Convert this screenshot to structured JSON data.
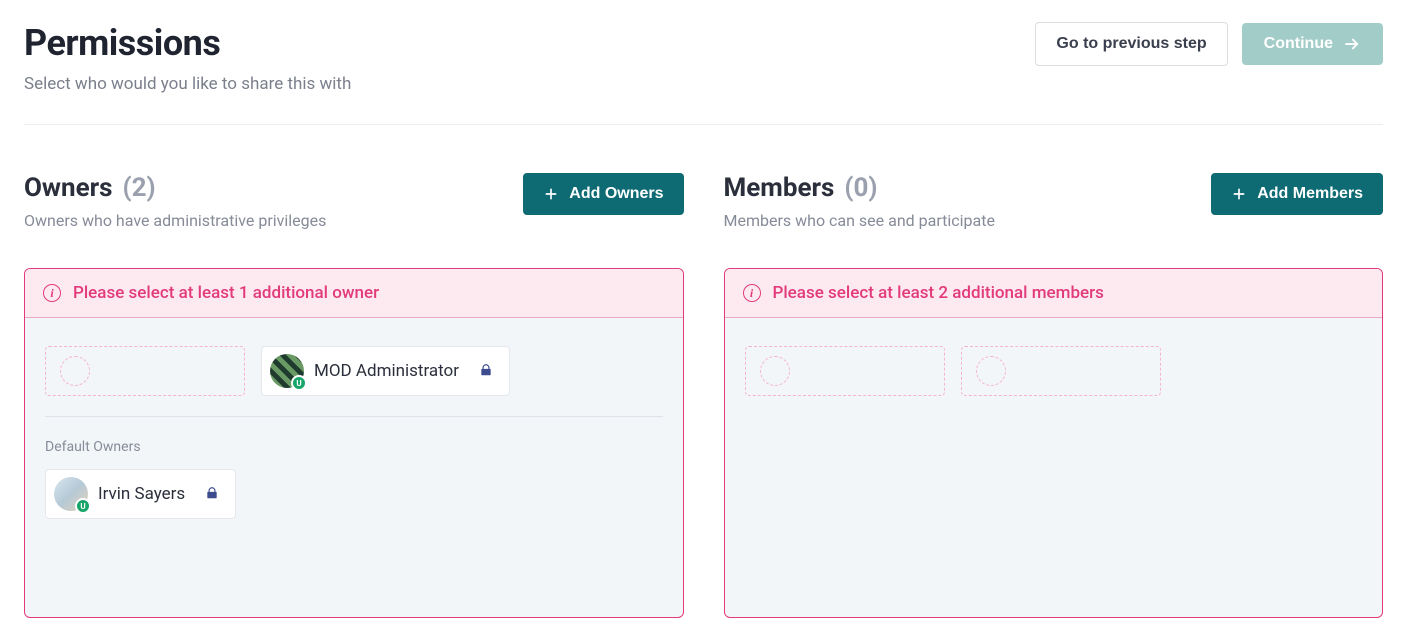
{
  "header": {
    "title": "Permissions",
    "subtitle": "Select who would you like to share this with",
    "prev_label": "Go to previous step",
    "continue_label": "Continue"
  },
  "owners": {
    "title": "Owners",
    "count": "(2)",
    "desc": "Owners who have administrative privileges",
    "add_label": "Add Owners",
    "warning": "Please select at least 1 additional owner",
    "chip1_name": "MOD Administrator",
    "default_label": "Default Owners",
    "chip2_name": "Irvin Sayers"
  },
  "members": {
    "title": "Members",
    "count": "(0)",
    "desc": "Members who can see and participate",
    "add_label": "Add Members",
    "warning": "Please select at least 2 additional members"
  }
}
